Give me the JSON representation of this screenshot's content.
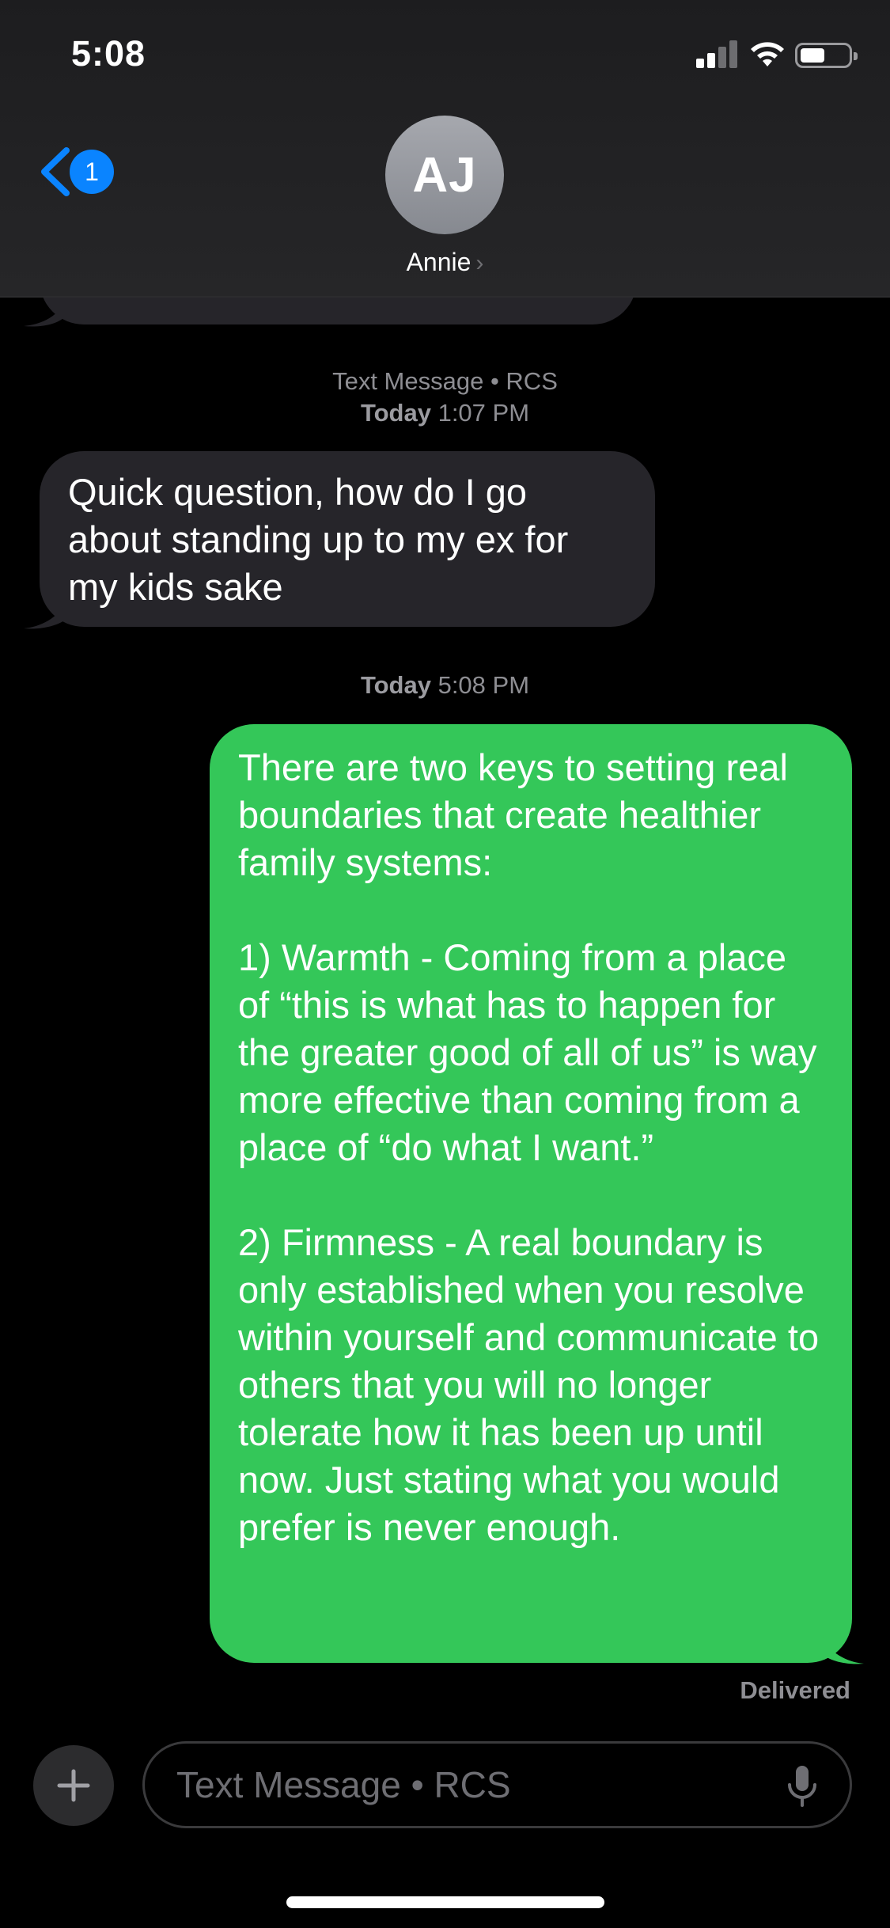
{
  "status_bar": {
    "time": "5:08"
  },
  "nav": {
    "unread_count": "1"
  },
  "contact": {
    "initials": "AJ",
    "name": "Annie",
    "chevron": "›"
  },
  "conversation": {
    "header_1": {
      "service": "Text Message • RCS",
      "day": "Today",
      "time": "1:07 PM"
    },
    "incoming_message": "Quick question, how do I go about standing up to my ex for my kids sake",
    "header_2": {
      "day": "Today",
      "time": "5:08 PM"
    },
    "outgoing_message": "There are two keys to setting real boundaries that create healthier family systems:\n\n1) Warmth - Coming from a place of “this is what has to happen for the greater good of all of us” is way more effective than coming from a place of “do what I want.”\n\n2) Firmness - A real boundary is only established when you resolve within yourself and communicate to others that you will no longer tolerate how it has been up until now. Just stating what you would prefer is never enough.",
    "delivery_status": "Delivered"
  },
  "composer": {
    "placeholder": "Text Message • RCS"
  },
  "colors": {
    "sent_bubble": "#34c759",
    "received_bubble": "#26252a",
    "accent": "#0a84ff"
  },
  "icons": [
    "back-chevron-icon",
    "plus-icon",
    "microphone-icon",
    "cellular-signal-icon",
    "wifi-icon",
    "battery-icon"
  ]
}
